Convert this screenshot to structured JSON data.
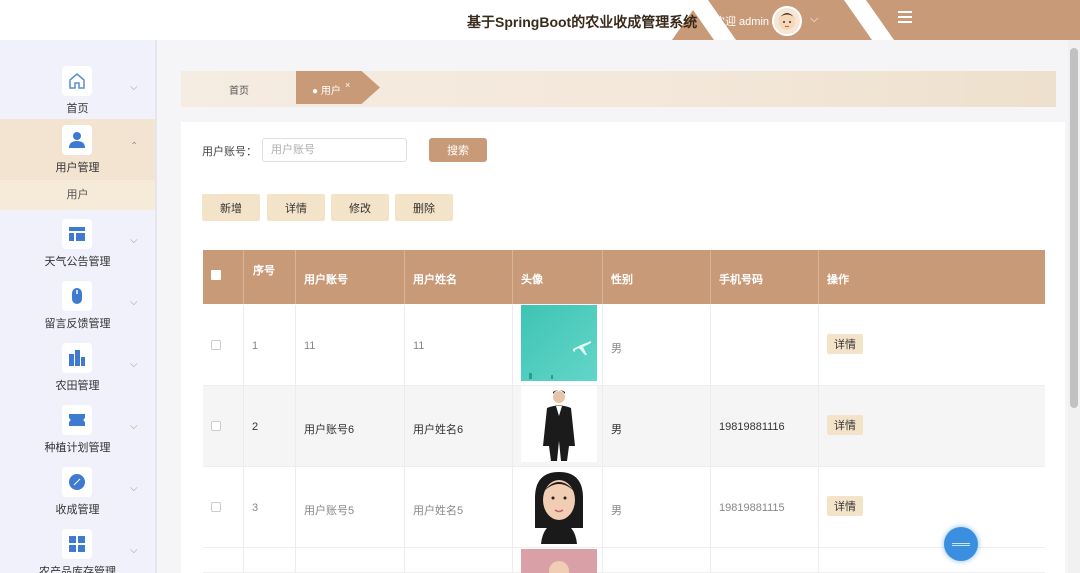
{
  "header": {
    "title": "基于SpringBoot的农业收成管理系统",
    "welcome": "欢迎 admin",
    "brand_color": "#c99a78"
  },
  "sidebar": {
    "items": [
      {
        "label": "首页",
        "icon": "home-icon"
      },
      {
        "label": "用户管理",
        "icon": "user-icon",
        "active": true,
        "sub": [
          {
            "label": "用户"
          }
        ]
      },
      {
        "label": "天气公告管理",
        "icon": "layout-icon"
      },
      {
        "label": "留言反馈管理",
        "icon": "mouse-icon"
      },
      {
        "label": "农田管理",
        "icon": "building-icon"
      },
      {
        "label": "种植计划管理",
        "icon": "ticket-icon"
      },
      {
        "label": "收成管理",
        "icon": "compass-icon"
      },
      {
        "label": "农产品库存管理",
        "icon": "grid-icon"
      }
    ]
  },
  "breadcrumb": {
    "home": "首页",
    "current": "用户"
  },
  "search": {
    "label": "用户账号：",
    "placeholder": "用户账号",
    "button": "搜索"
  },
  "actions": {
    "add": "新增",
    "detail": "详情",
    "edit": "修改",
    "delete": "删除"
  },
  "table": {
    "headers": [
      "序号",
      "用户账号",
      "用户姓名",
      "头像",
      "性别",
      "手机号码",
      "操作"
    ],
    "rows": [
      {
        "index": "1",
        "account": "11",
        "name": "11",
        "gender": "男",
        "phone": "",
        "action": "详情",
        "avatar": "teal-airplane"
      },
      {
        "index": "2",
        "account": "用户账号6",
        "name": "用户姓名6",
        "gender": "男",
        "phone": "19819881116",
        "action": "详情",
        "avatar": "woman-suit"
      },
      {
        "index": "3",
        "account": "用户账号5",
        "name": "用户姓名5",
        "gender": "男",
        "phone": "19819881115",
        "action": "详情",
        "avatar": "woman-portrait"
      }
    ]
  }
}
